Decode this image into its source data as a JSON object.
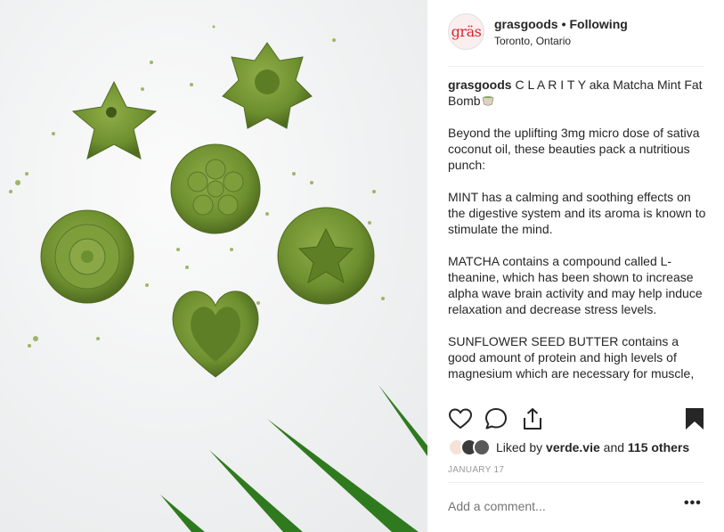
{
  "post": {
    "username": "grasgoods",
    "avatar_text": "gräs",
    "separator": "•",
    "follow_label": "Following",
    "location": "Toronto, Ontario",
    "caption": {
      "username": "grasgoods",
      "title": "C L A R I T Y aka Matcha Mint Fat Bomb",
      "paragraphs": [
        "Beyond the uplifting 3mg micro dose of sativa coconut oil, these beauties pack a nutritious punch:",
        "MINT has a calming and soothing effects on the digestive system and its aroma is known to stimulate the mind.",
        "MATCHA contains a compound called L-theanine, which has been shown to increase alpha wave brain activity and may help induce relaxation and decrease stress levels.",
        "SUNFLOWER SEED BUTTER contains a good amount of protein and high levels of magnesium which are necessary for muscle,"
      ]
    },
    "actions": {
      "like_icon": "heart-icon",
      "comment_icon": "comment-bubble-icon",
      "share_icon": "share-icon",
      "save_icon": "bookmark-icon"
    },
    "likes": {
      "prefix": "Liked by",
      "user": "verde.vie",
      "and": "and",
      "count_text": "115 others"
    },
    "date": "JANUARY 17",
    "comment_placeholder": "Add a comment...",
    "more_label": "•••",
    "colors": {
      "avatar_brand": "#d9232e",
      "text": "#262626",
      "muted": "#999999",
      "matcha": "#7a9a3a"
    }
  }
}
